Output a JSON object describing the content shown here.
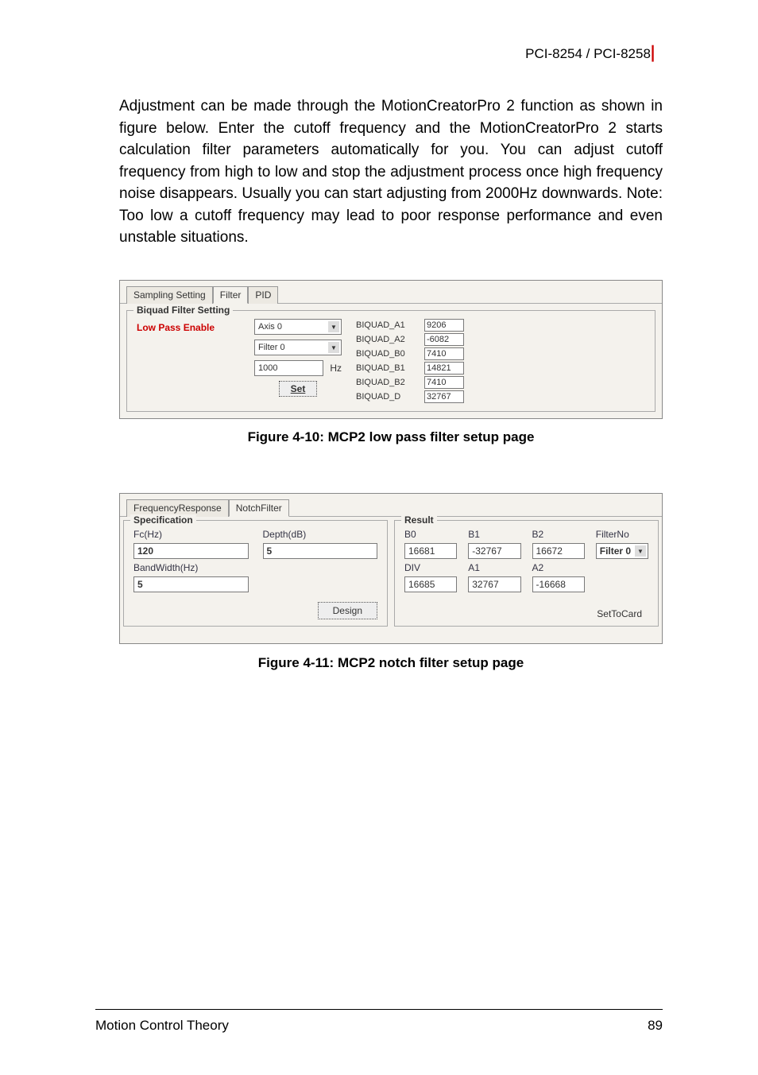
{
  "header": {
    "product": "PCI-8254 / PCI-8258"
  },
  "body_paragraph": "Adjustment can be made through the MotionCreatorPro 2 function as shown in figure below. Enter the cutoff frequency and the MotionCreatorPro 2 starts calculation filter parameters automatically for you. You can adjust cutoff frequency from high to low and stop the adjustment process once high frequency noise disappears. Usually you can start adjusting from 2000Hz downwards. Note: Too low a cutoff frequency may lead to poor response performance and even unstable situations.",
  "panel1": {
    "tabs": {
      "t1": "Sampling Setting",
      "t2": "Filter",
      "t3": "PID"
    },
    "fieldset_title": "Biquad Filter Setting",
    "low_pass_label": "Low Pass Enable",
    "axis_dd": "Axis 0",
    "filter_dd": "Filter 0",
    "hz_value": "1000",
    "hz_label": "Hz",
    "set_button": "Set",
    "biquad": {
      "a1": {
        "label": "BIQUAD_A1",
        "value": "9206"
      },
      "a2": {
        "label": "BIQUAD_A2",
        "value": "-6082"
      },
      "b0": {
        "label": "BIQUAD_B0",
        "value": "7410"
      },
      "b1": {
        "label": "BIQUAD_B1",
        "value": "14821"
      },
      "b2": {
        "label": "BIQUAD_B2",
        "value": "7410"
      },
      "d": {
        "label": "BIQUAD_D",
        "value": "32767"
      }
    }
  },
  "caption1": "Figure 4-10: MCP2 low pass filter setup page",
  "panel2": {
    "tabs": {
      "t1": "FrequencyResponse",
      "t2": "NotchFilter"
    },
    "spec": {
      "title": "Specification",
      "fc_label": "Fc(Hz)",
      "fc_value": "120",
      "depth_label": "Depth(dB)",
      "depth_value": "5",
      "bw_label": "BandWidth(Hz)",
      "bw_value": "5",
      "design_button": "Design"
    },
    "result": {
      "title": "Result",
      "b0_label": "B0",
      "b0_value": "16681",
      "b1_label": "B1",
      "b1_value": "-32767",
      "b2_label": "B2",
      "b2_value": "16672",
      "div_label": "DIV",
      "div_value": "16685",
      "a1_label": "A1",
      "a1_value": "32767",
      "a2_label": "A2",
      "a2_value": "-16668",
      "filterno_label": "FilterNo",
      "filterno_value": "Filter 0",
      "settocard": "SetToCard"
    }
  },
  "caption2": "Figure 4-11: MCP2 notch filter setup page",
  "footer": {
    "left": "Motion Control Theory",
    "right": "89"
  }
}
